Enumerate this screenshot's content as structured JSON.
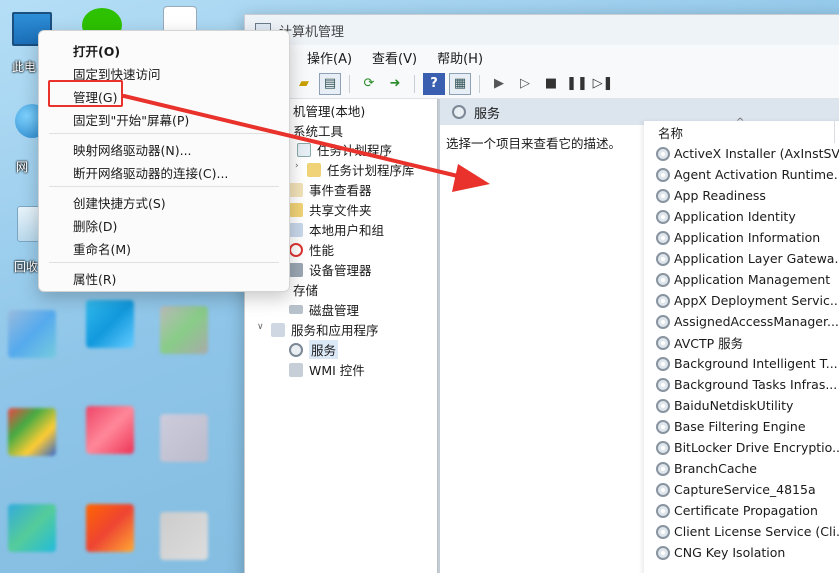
{
  "desktop": {
    "icons": [
      {
        "name": "this-pc",
        "label": "此电"
      },
      {
        "name": "network",
        "label": "网"
      },
      {
        "name": "recycle-bin",
        "label": "回收"
      }
    ]
  },
  "context_menu": {
    "items": [
      {
        "label": "打开(O)"
      },
      {
        "label": "固定到快速访问"
      },
      {
        "label": "管理(G)"
      },
      {
        "label": "固定到\"开始\"屏幕(P)"
      },
      {
        "label": "映射网络驱动器(N)..."
      },
      {
        "label": "断开网络驱动器的连接(C)..."
      },
      {
        "label": "创建快捷方式(S)"
      },
      {
        "label": "删除(D)"
      },
      {
        "label": "重命名(M)"
      },
      {
        "label": "属性(R)"
      }
    ]
  },
  "window": {
    "title": "计算机管理",
    "menu": [
      "操作(A)",
      "查看(V)",
      "帮助(H)"
    ],
    "tree": [
      {
        "label": "机管理(本地)"
      },
      {
        "label": "系统工具"
      },
      {
        "label": "任务计划程序"
      },
      {
        "label": "任务计划程序库"
      },
      {
        "label": "事件查看器"
      },
      {
        "label": "共享文件夹"
      },
      {
        "label": "本地用户和组"
      },
      {
        "label": "性能"
      },
      {
        "label": "设备管理器"
      },
      {
        "label": "存储"
      },
      {
        "label": "磁盘管理"
      },
      {
        "label": "服务和应用程序"
      },
      {
        "label": "服务"
      },
      {
        "label": "WMI 控件"
      }
    ],
    "services_header": "服务",
    "description": "选择一个项目来查看它的描述。",
    "column_name": "名称",
    "services": [
      "ActiveX Installer (AxInstSV)",
      "Agent Activation Runtime...",
      "App Readiness",
      "Application Identity",
      "Application Information",
      "Application Layer Gatewa...",
      "Application Management",
      "AppX Deployment Servic...",
      "AssignedAccessManager...",
      "AVCTP 服务",
      "Background Intelligent T...",
      "Background Tasks Infras...",
      "BaiduNetdiskUtility",
      "Base Filtering Engine",
      "BitLocker Drive Encryptio...",
      "BranchCache",
      "CaptureService_4815a",
      "Certificate Propagation",
      "Client License Service (Cli...",
      "CNG Key Isolation"
    ]
  },
  "colors": {
    "highlight": "#e8322b",
    "arrow": "#e8322b"
  }
}
